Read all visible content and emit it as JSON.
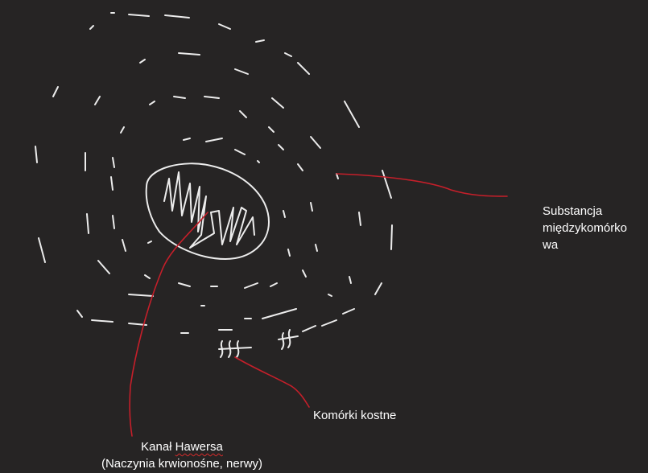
{
  "labels": {
    "substance": [
      "Substancja",
      "międzykomórko",
      "wa"
    ],
    "cells": "Komórki kostne",
    "canal_prefix": "Kanał ",
    "canal_word": "Hawersa",
    "canal_sub": "(Naczynia krwionośne, nerwy)"
  },
  "colors": {
    "background": "#262424",
    "chalk": "#ececec",
    "pointer": "#c51f2a",
    "spellcheck": "#d62a2a",
    "text": "#ffffff"
  }
}
